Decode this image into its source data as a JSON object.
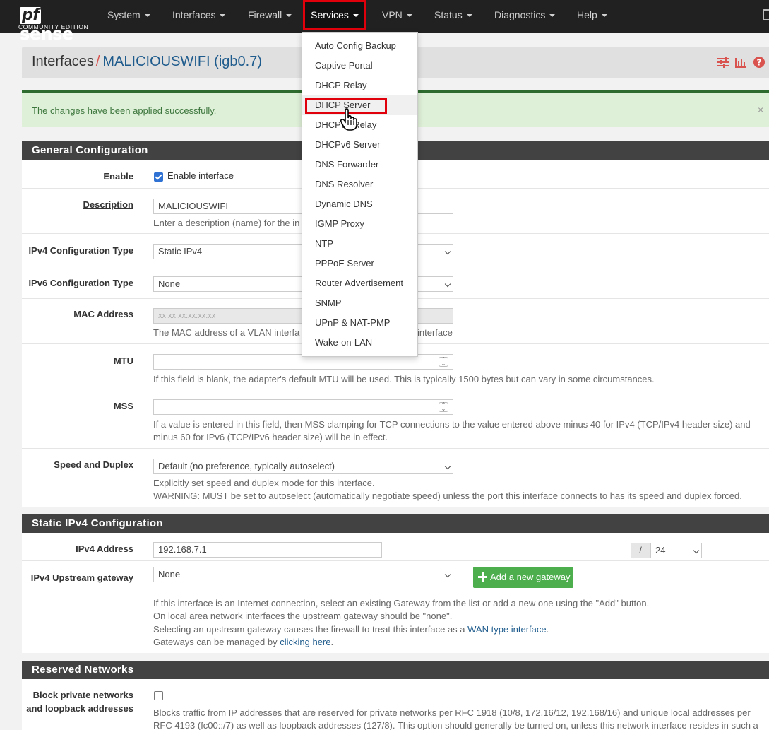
{
  "navbar": {
    "brand_logo_pf": "pf",
    "brand_logo_rest": "sense",
    "brand_sub": "COMMUNITY EDITION",
    "items": [
      {
        "label": "System"
      },
      {
        "label": "Interfaces"
      },
      {
        "label": "Firewall"
      },
      {
        "label": "Services"
      },
      {
        "label": "VPN"
      },
      {
        "label": "Status"
      },
      {
        "label": "Diagnostics"
      },
      {
        "label": "Help"
      }
    ]
  },
  "services_menu": {
    "items": [
      "Auto Config Backup",
      "Captive Portal",
      "DHCP Relay",
      "DHCP Server",
      "DHCPv6 Relay",
      "DHCPv6 Server",
      "DNS Forwarder",
      "DNS Resolver",
      "Dynamic DNS",
      "IGMP Proxy",
      "NTP",
      "PPPoE Server",
      "Router Advertisement",
      "SNMP",
      "UPnP & NAT-PMP",
      "Wake-on-LAN"
    ],
    "highlighted": "DHCP Server"
  },
  "header": {
    "section": "Interfaces",
    "separator": "/",
    "interface": "MALICIOUSWIFI (igb0.7)"
  },
  "alert": {
    "text": "The changes have been applied successfully.",
    "close": "×"
  },
  "general": {
    "title": "General Configuration",
    "enable_label": "Enable",
    "enable_text": "Enable interface",
    "description_label": "Description",
    "description_value": "MALICIOUSWIFI",
    "description_help": "Enter a description (name) for the in",
    "ipv4_type_label": "IPv4 Configuration Type",
    "ipv4_type_value": "Static IPv4",
    "ipv6_type_label": "IPv6 Configuration Type",
    "ipv6_type_value": "None",
    "mac_label": "MAC Address",
    "mac_placeholder": "xx:xx:xx:xx:xx:xx",
    "mac_help_a": "The MAC address of a VLAN interfa",
    "mac_help_b": "interface",
    "mtu_label": "MTU",
    "mtu_help": "If this field is blank, the adapter's default MTU will be used. This is typically 1500 bytes but can vary in some circumstances.",
    "mss_label": "MSS",
    "mss_help_1": "If a value is entered in this field, then MSS clamping for TCP connections to the value entered above minus 40 for IPv4 (TCP/IPv4 header size) and",
    "mss_help_2": "minus 60 for IPv6 (TCP/IPv6 header size) will be in effect.",
    "speed_label": "Speed and Duplex",
    "speed_value": "Default (no preference, typically autoselect)",
    "speed_help_1": "Explicitly set speed and duplex mode for this interface.",
    "speed_help_2": "WARNING: MUST be set to autoselect (automatically negotiate speed) unless the port this interface connects to has its speed and duplex forced."
  },
  "static_ipv4": {
    "title": "Static IPv4 Configuration",
    "address_label": "IPv4 Address",
    "address_value": "192.168.7.1",
    "slash": "/",
    "cidr_value": "24",
    "gateway_label": "IPv4 Upstream gateway",
    "gateway_value": "None",
    "add_gateway_label": "Add a new gateway",
    "help_1": "If this interface is an Internet connection, select an existing Gateway from the list or add a new one using the \"Add\" button.",
    "help_2": "On local area network interfaces the upstream gateway should be \"none\".",
    "help_3a": "Selecting an upstream gateway causes the firewall to treat this interface as a ",
    "help_3_link": "WAN type interface",
    "help_3b": ".",
    "help_4a": "Gateways can be managed by ",
    "help_4_link": "clicking here",
    "help_4b": "."
  },
  "reserved": {
    "title": "Reserved Networks",
    "block_label_1": "Block private networks",
    "block_label_2": "and loopback addresses",
    "help_1": "Blocks traffic from IP addresses that are reserved for private networks per RFC 1918 (10/8, 172.16/12, 192.168/16) and unique local addresses per",
    "help_2": "RFC 4193 (fc00::/7) as well as loopback addresses (127/8). This option should generally be turned on, unless this network interface resides in such a"
  },
  "colors": {
    "navbar": "#212121",
    "highlight": "#e0000b",
    "panel_head": "#424242",
    "success_bg": "#dff0d8",
    "add_button": "#4cae4c",
    "link": "#1f5c8d"
  }
}
